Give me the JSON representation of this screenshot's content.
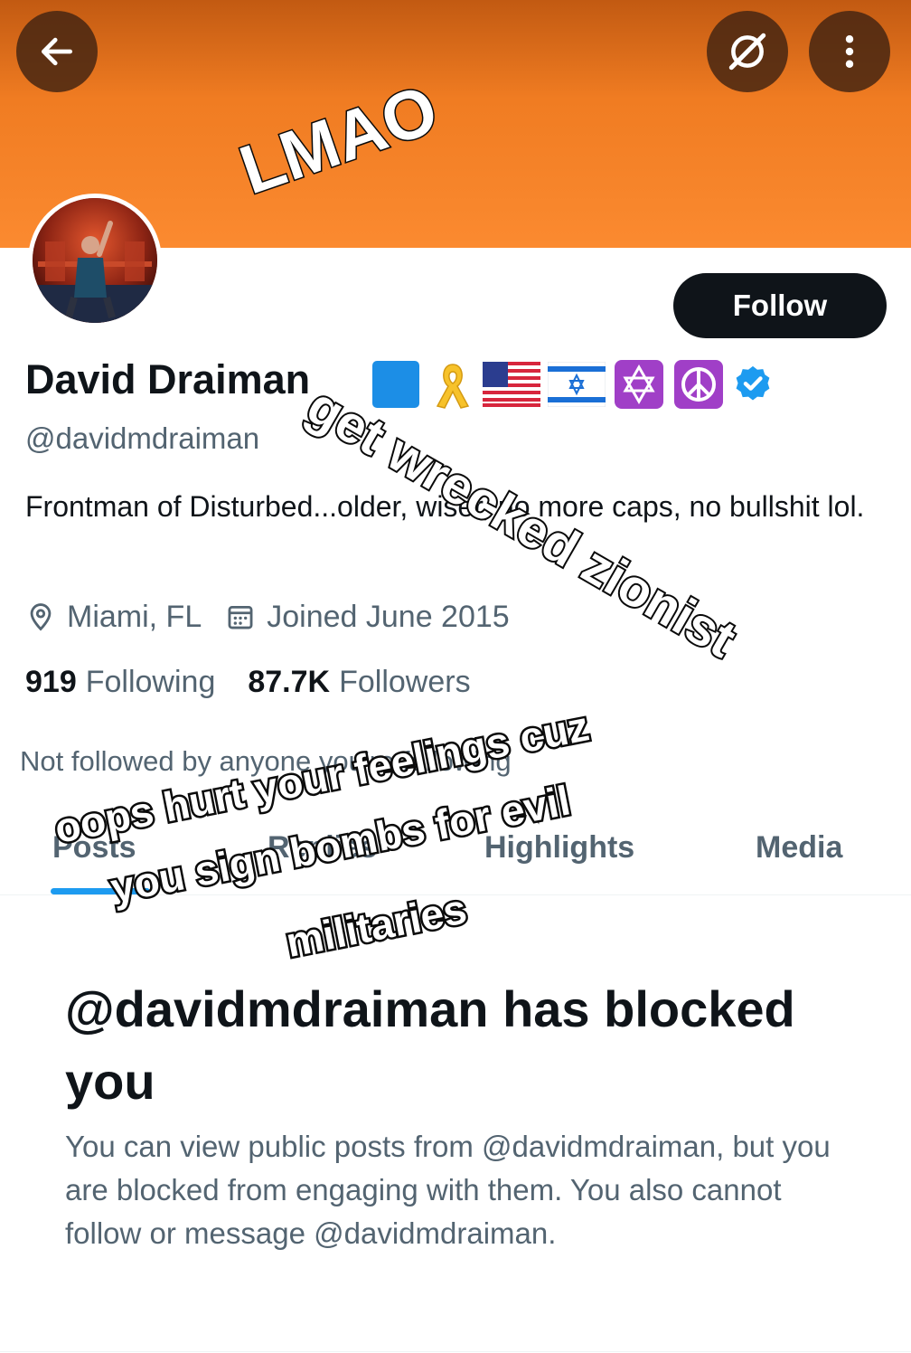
{
  "header": {
    "back_icon": "arrow-left-icon",
    "grok_icon": "grok-icon",
    "more_icon": "vertical-ellipsis-icon",
    "banner_color": "#fb8a30"
  },
  "profile": {
    "follow_label": "Follow",
    "name": "David Draiman",
    "badges": [
      "blue-square-emoji",
      "yellow-ribbon-emoji",
      "us-flag-emoji",
      "israel-flag-emoji",
      "star-of-david-emoji",
      "peace-symbol-emoji",
      "verified-badge-icon"
    ],
    "handle": "@davidmdraiman",
    "bio": "Frontman of Disturbed...older, wiser, no more caps, no bullshit lol.",
    "location": "Miami, FL",
    "joined": "Joined June 2015",
    "following_count": "919",
    "following_label": "Following",
    "followers_count": "87.7K",
    "followers_label": "Followers",
    "not_followed": "Not followed by anyone you're following",
    "accent_color": "#1d9bf0"
  },
  "tabs": [
    {
      "label": "Posts"
    },
    {
      "label": "Replies"
    },
    {
      "label": "Highlights"
    },
    {
      "label": "Media"
    }
  ],
  "blocked": {
    "title": "@davidmdraiman has blocked you",
    "body": "You can view public posts from @davidmdraiman, but you are blocked from engaging with them. You also cannot follow or message @davidmdraiman."
  },
  "overlay_captions": {
    "lmao": "LMAO",
    "zionist": "get wrecked zionist",
    "line1": "oops hurt your feelings cuz",
    "line2": "you sign bombs for evil",
    "line3": "militaries"
  }
}
